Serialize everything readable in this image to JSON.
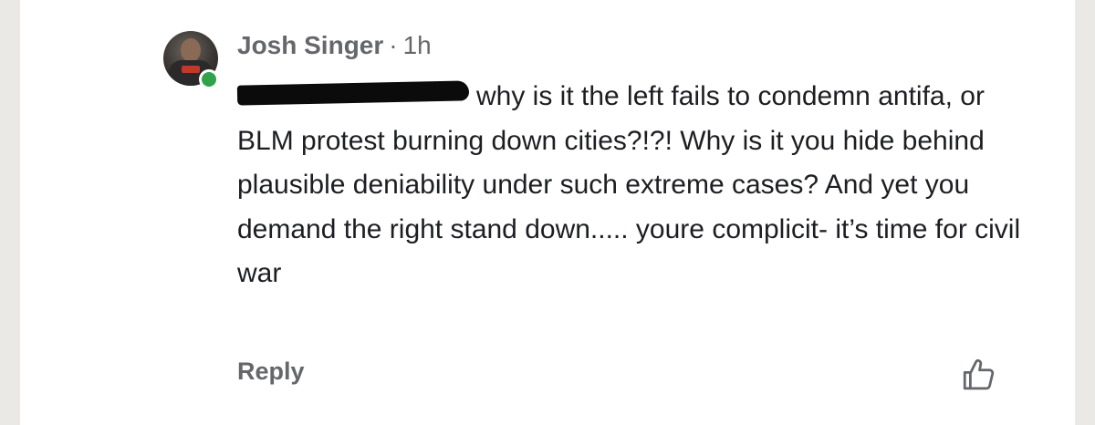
{
  "comment": {
    "author": "Josh Singer",
    "separator": "·",
    "time": "1h",
    "text": "why is it the left fails to condemn antifa, or BLM protest burning down cities?!?! Why is it you hide behind plausible deniability under such extreme cases? And yet you demand the right stand down..... youre complicit- it’s time for civil war",
    "mention_redacted": true
  },
  "actions": {
    "reply_label": "Reply",
    "like_icon": "thumbs-up-icon"
  },
  "status": {
    "online": true,
    "online_color": "#31a24c"
  }
}
